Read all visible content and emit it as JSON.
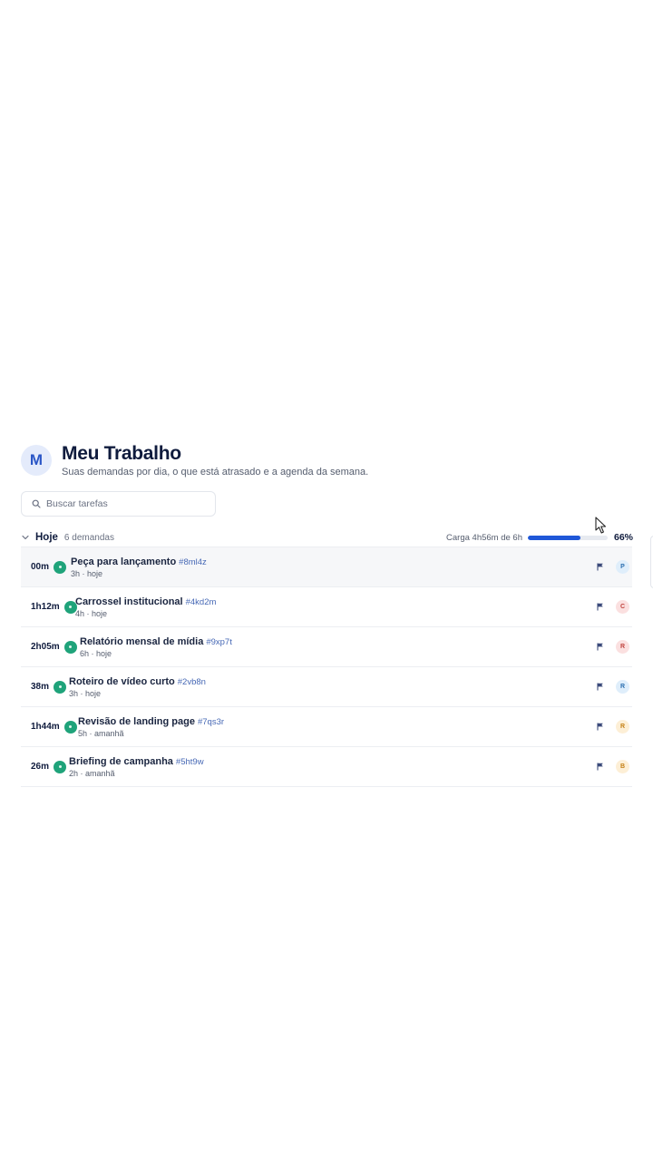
{
  "header": {
    "avatar_initial": "M",
    "title": "Meu Trabalho",
    "subtitle": "Suas demandas por dia, o que está atrasado e a agenda da semana."
  },
  "search": {
    "placeholder": "Buscar tarefas",
    "value": ""
  },
  "group": {
    "title": "Hoje",
    "count": "6 demandas",
    "load_label": "Carga 4h56m de 6h",
    "load_percent_label": "66%",
    "load_fraction": 0.66
  },
  "colors": {
    "accent": "#1f57d8",
    "status_green": "#1fa37a",
    "title": "#0f1b3d"
  },
  "tasks": [
    {
      "time": "00m",
      "title": "Peça para lançamento",
      "id": "#8ml4z",
      "meta": "3h · hoje",
      "assignee": "P",
      "avatar_bg": "#dfeefb",
      "avatar_fg": "#2c6fb0",
      "icon": "flag-icon"
    },
    {
      "time": "1h12m",
      "title": "Carrossel institucional",
      "id": "#4kd2m",
      "meta": "4h · hoje",
      "assignee": "C",
      "avatar_bg": "#fbe0e0",
      "avatar_fg": "#c0443f",
      "icon": "flag-icon"
    },
    {
      "time": "2h05m",
      "title": "Relatório mensal de mídia",
      "id": "#9xp7t",
      "meta": "6h · hoje",
      "assignee": "R",
      "avatar_bg": "#fbe0e0",
      "avatar_fg": "#c0443f",
      "icon": "flag-icon"
    },
    {
      "time": "38m",
      "title": "Roteiro de vídeo curto",
      "id": "#2vb8n",
      "meta": "3h · hoje",
      "assignee": "R",
      "avatar_bg": "#dfeefb",
      "avatar_fg": "#2c6fb0",
      "icon": "flag-icon"
    },
    {
      "time": "1h44m",
      "title": "Revisão de landing page",
      "id": "#7qs3r",
      "meta": "5h · amanhã",
      "assignee": "R",
      "avatar_bg": "#fdefd6",
      "avatar_fg": "#c47f14",
      "icon": "flag-icon"
    },
    {
      "time": "26m",
      "title": "Briefing de campanha",
      "id": "#5ht9w",
      "meta": "2h · amanhã",
      "assignee": "B",
      "avatar_bg": "#fdefd6",
      "avatar_fg": "#c47f14",
      "icon": "flag-icon"
    }
  ]
}
